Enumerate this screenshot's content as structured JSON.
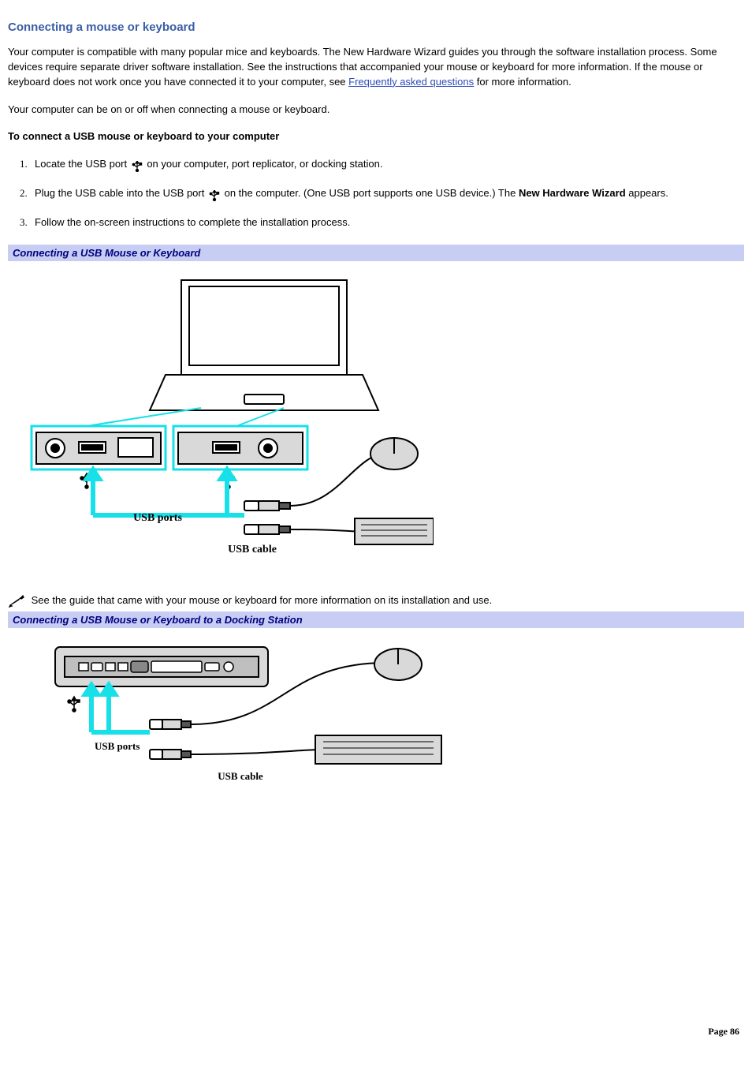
{
  "heading": "Connecting a mouse or keyboard",
  "intro": {
    "p1a": "Your computer is compatible with many popular mice and keyboards. The New Hardware Wizard guides you through the software installation process. Some devices require separate driver software installation. See the instructions that accompanied your mouse or keyboard for more information. If the mouse or keyboard does not work once you have connected it to your computer, see ",
    "faq_link": "Frequently asked questions",
    "p1b": " for more information.",
    "p2": "Your computer can be on or off when connecting a mouse or keyboard."
  },
  "subhead": "To connect a USB mouse or keyboard to your computer",
  "steps": {
    "s1a": "Locate the USB port ",
    "s1b": " on your computer, port replicator, or docking station.",
    "s2a": "Plug the USB cable into the USB port ",
    "s2b": " on the computer. (One USB port supports one USB device.) The ",
    "s2bold": "New Hardware Wizard",
    "s2c": " appears.",
    "s3": "Follow the on-screen instructions to complete the installation process."
  },
  "fig1": {
    "caption": "Connecting a USB Mouse or Keyboard",
    "label_ports": "USB ports",
    "label_cable": "USB cable"
  },
  "note": "See the guide that came with your mouse or keyboard for more information on its installation and use.",
  "fig2": {
    "caption": "Connecting a USB Mouse or Keyboard to a Docking Station",
    "label_ports": "USB ports",
    "label_cable": "USB cable"
  },
  "footer": "Page 86"
}
